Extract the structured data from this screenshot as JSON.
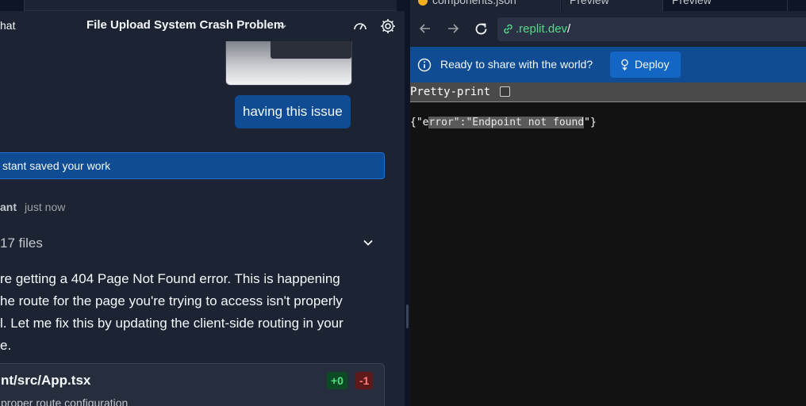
{
  "left_panel": {
    "header": {
      "chat_label": "hat",
      "title": "File Upload System Crash Problem"
    },
    "user_message": "having this issue",
    "saved_notice": "stant saved your work",
    "assistant": {
      "name": "ant",
      "timestamp": "just now"
    },
    "files_summary": "17 files",
    "response_lines": [
      "re getting a 404 Page Not Found error. This is happening",
      "he route for the page you're trying to access isn't properly",
      "l. Let me fix this by updating the client-side routing in your",
      "e."
    ],
    "file_change": {
      "path": "nt/src/App.tsx",
      "description": "proper route configuration",
      "added": "+0",
      "removed": "-1"
    }
  },
  "right_panel": {
    "tabs": [
      {
        "label": "components.json"
      },
      {
        "label": "Preview"
      },
      {
        "label": "Preview"
      }
    ],
    "url": {
      "domain": ".replit.dev",
      "path": "/"
    },
    "banner": {
      "text": "Ready to share with the world?",
      "deploy_label": "Deploy"
    },
    "viewport": {
      "pretty_print_label": "Pretty-print",
      "json_prefix": "{\"e",
      "json_highlight": "rror\":\"Endpoint not found",
      "json_suffix": "\"}"
    }
  },
  "colors": {
    "pane_bg": "#1c2333",
    "accent_blue": "#0f4c94",
    "link_green": "#58d88a",
    "add_green": "#4ee07e",
    "remove_red": "#ff7b7b"
  }
}
